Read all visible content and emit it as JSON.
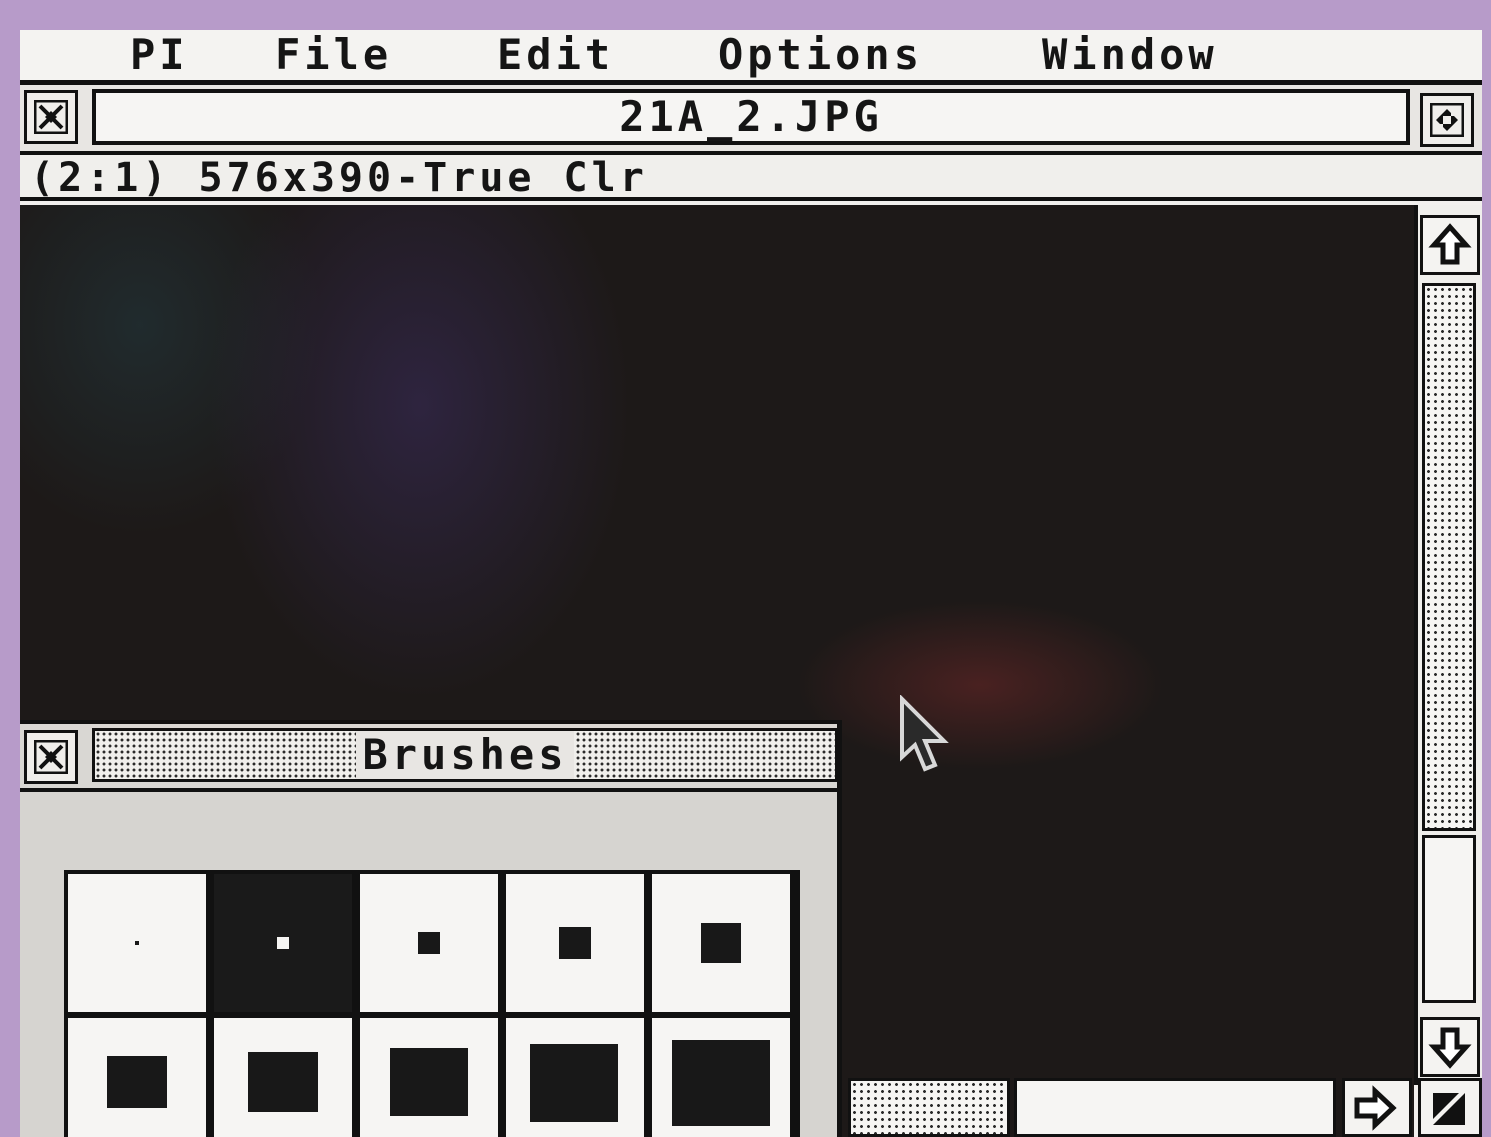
{
  "menubar": {
    "items": [
      {
        "label": "PI"
      },
      {
        "label": "File"
      },
      {
        "label": "Edit"
      },
      {
        "label": "Options"
      },
      {
        "label": "Window"
      }
    ]
  },
  "window": {
    "title": "21A_2.JPG",
    "info": "(2:1) 576x390-True Clr",
    "close_icon": "close-box-icon",
    "fuller_icon": "fuller-box-icon"
  },
  "scrollbars": {
    "up_icon": "arrow-up-icon",
    "down_icon": "arrow-down-icon",
    "right_icon": "arrow-right-icon",
    "sizer_icon": "size-box-icon"
  },
  "brushes": {
    "title": "Brushes",
    "selected_index": 1,
    "count_visible": 10
  },
  "colors": {
    "desktop": "#b79bc9",
    "window_bg": "#f2f0ee",
    "frame": "#111111",
    "canvas": "#1d1918"
  }
}
